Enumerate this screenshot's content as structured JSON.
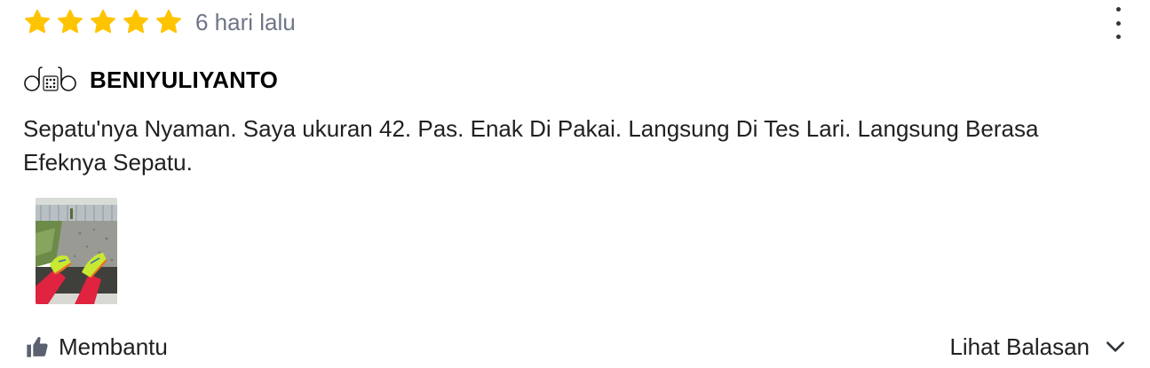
{
  "review": {
    "rating": 5,
    "rating_max": 5,
    "star_color": "#ffc400",
    "timestamp": "6 hari lalu",
    "more_icon": "more-vertical-icon",
    "reviewer": {
      "avatar_icon": "avatar-logo",
      "name": "BENIYULIYANTO"
    },
    "text": "Sepatu'nya Nyaman. Saya ukuran 42. Pas. Enak Di Pakai. Langsung Di Tes Lari. Langsung Berasa Efeknya Sepatu.",
    "photos": [
      {
        "icon": "review-photo-thumbnail"
      }
    ],
    "actions": {
      "helpful_icon": "thumbs-up-icon",
      "helpful_label": "Membantu",
      "replies_label": "Lihat Balasan",
      "replies_icon": "chevron-down-icon"
    }
  }
}
